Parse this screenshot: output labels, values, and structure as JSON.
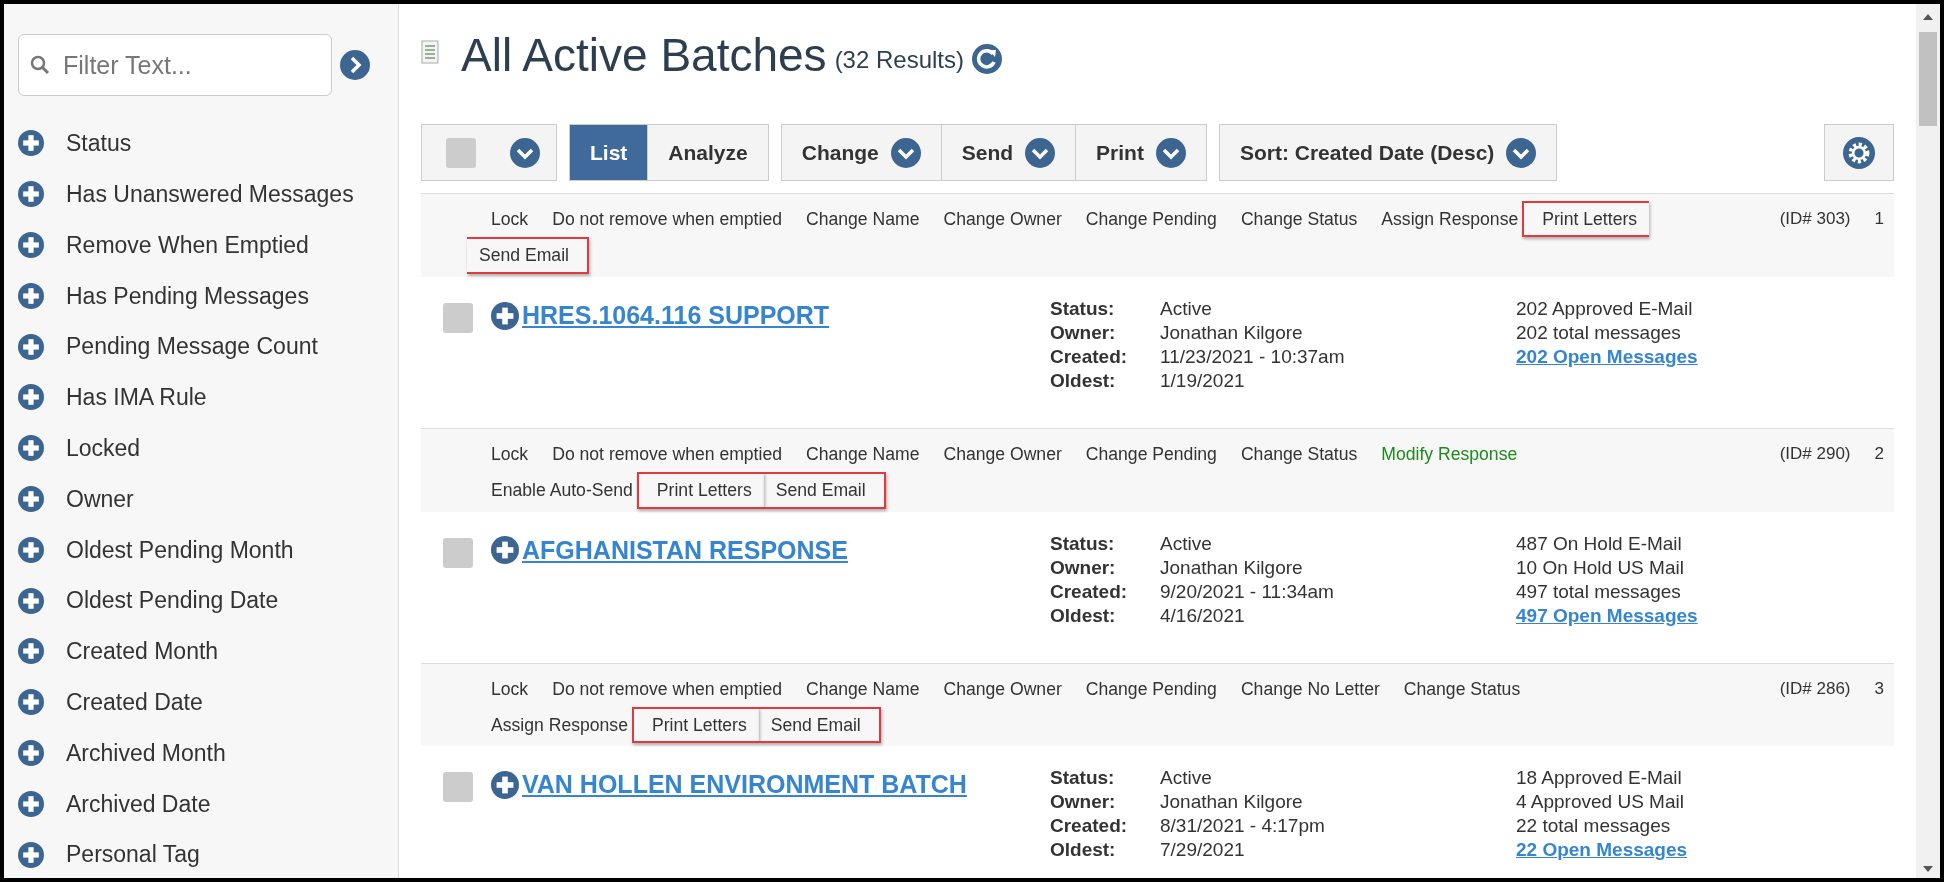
{
  "sidebar": {
    "filter": {
      "placeholder": "Filter Text..."
    },
    "filters": [
      {
        "label": "Status"
      },
      {
        "label": "Has Unanswered Messages"
      },
      {
        "label": "Remove When Emptied"
      },
      {
        "label": "Has Pending Messages"
      },
      {
        "label": "Pending Message Count"
      },
      {
        "label": "Has IMA Rule"
      },
      {
        "label": "Locked"
      },
      {
        "label": "Owner"
      },
      {
        "label": "Oldest Pending Month"
      },
      {
        "label": "Oldest Pending Date"
      },
      {
        "label": "Created Month"
      },
      {
        "label": "Created Date"
      },
      {
        "label": "Archived Month"
      },
      {
        "label": "Archived Date"
      },
      {
        "label": "Personal Tag"
      }
    ]
  },
  "header": {
    "title": "All Active Batches",
    "count": "(32 Results)"
  },
  "toolbar": {
    "select_all": {
      "checked": false
    },
    "views": [
      {
        "label": "List",
        "selected": true
      },
      {
        "label": "Analyze",
        "selected": false
      }
    ],
    "menus": [
      "Change",
      "Send",
      "Print"
    ],
    "sort": "Sort: Created Date (Desc)"
  },
  "batches": [
    {
      "actions": [
        {
          "label": "Lock",
          "highlighted": false
        },
        {
          "label": "Do not remove when emptied",
          "highlighted": false
        },
        {
          "label": "Change Name",
          "highlighted": false
        },
        {
          "label": "Change Owner",
          "highlighted": false
        },
        {
          "label": "Change Pending",
          "highlighted": false
        },
        {
          "label": "Change Status",
          "highlighted": false
        },
        {
          "label": "Assign Response",
          "highlighted": false
        },
        {
          "label": "Print Letters",
          "highlighted": true
        },
        {
          "label": "Send Email",
          "highlighted": true
        }
      ],
      "id": "(ID# 303)",
      "number": "1",
      "checked": false,
      "name": "HRES.1064.116 SUPPORT",
      "details": [
        {
          "label": "Status:",
          "value": "Active"
        },
        {
          "label": "Owner:",
          "value": "Jonathan Kilgore"
        },
        {
          "label": "Created:",
          "value": "11/23/2021 - 10:37am"
        },
        {
          "label": "Oldest:",
          "value": "1/19/2021"
        }
      ],
      "counts": [
        "202 Approved E-Mail",
        "202 total messages"
      ],
      "open_link": "202 Open Messages"
    },
    {
      "actions": [
        {
          "label": "Lock",
          "highlighted": false
        },
        {
          "label": "Do not remove when emptied",
          "highlighted": false
        },
        {
          "label": "Change Name",
          "highlighted": false
        },
        {
          "label": "Change Owner",
          "highlighted": false
        },
        {
          "label": "Change Pending",
          "highlighted": false
        },
        {
          "label": "Change Status",
          "highlighted": false
        },
        {
          "label": "Modify Response",
          "highlighted": false,
          "color": "#1e8a1e"
        },
        {
          "label": "Enable Auto-Send",
          "highlighted": false
        },
        {
          "label": "Print Letters",
          "highlighted": true
        },
        {
          "label": "Send Email",
          "highlighted": true
        }
      ],
      "id": "(ID# 290)",
      "number": "2",
      "checked": false,
      "name": "AFGHANISTAN RESPONSE",
      "details": [
        {
          "label": "Status:",
          "value": "Active"
        },
        {
          "label": "Owner:",
          "value": "Jonathan Kilgore"
        },
        {
          "label": "Created:",
          "value": "9/20/2021 - 11:34am"
        },
        {
          "label": "Oldest:",
          "value": "4/16/2021"
        }
      ],
      "counts": [
        "487 On Hold E-Mail",
        "10 On Hold US Mail",
        "497 total messages"
      ],
      "open_link": "497 Open Messages"
    },
    {
      "actions": [
        {
          "label": "Lock",
          "highlighted": false
        },
        {
          "label": "Do not remove when emptied",
          "highlighted": false
        },
        {
          "label": "Change Name",
          "highlighted": false
        },
        {
          "label": "Change Owner",
          "highlighted": false
        },
        {
          "label": "Change Pending",
          "highlighted": false
        },
        {
          "label": "Change No Letter",
          "highlighted": false
        },
        {
          "label": "Change Status",
          "highlighted": false
        },
        {
          "label": "Assign Response",
          "highlighted": false
        },
        {
          "label": "Print Letters",
          "highlighted": true
        },
        {
          "label": "Send Email",
          "highlighted": true
        }
      ],
      "id": "(ID# 286)",
      "number": "3",
      "checked": false,
      "name": "VAN HOLLEN ENVIRONMENT BATCH",
      "details": [
        {
          "label": "Status:",
          "value": "Active"
        },
        {
          "label": "Owner:",
          "value": "Jonathan Kilgore"
        },
        {
          "label": "Created:",
          "value": "8/31/2021 - 4:17pm"
        },
        {
          "label": "Oldest:",
          "value": "7/29/2021"
        }
      ],
      "counts": [
        "18 Approved E-Mail",
        "4 Approved US Mail",
        "22 total messages"
      ],
      "open_link": "22 Open Messages"
    }
  ]
}
